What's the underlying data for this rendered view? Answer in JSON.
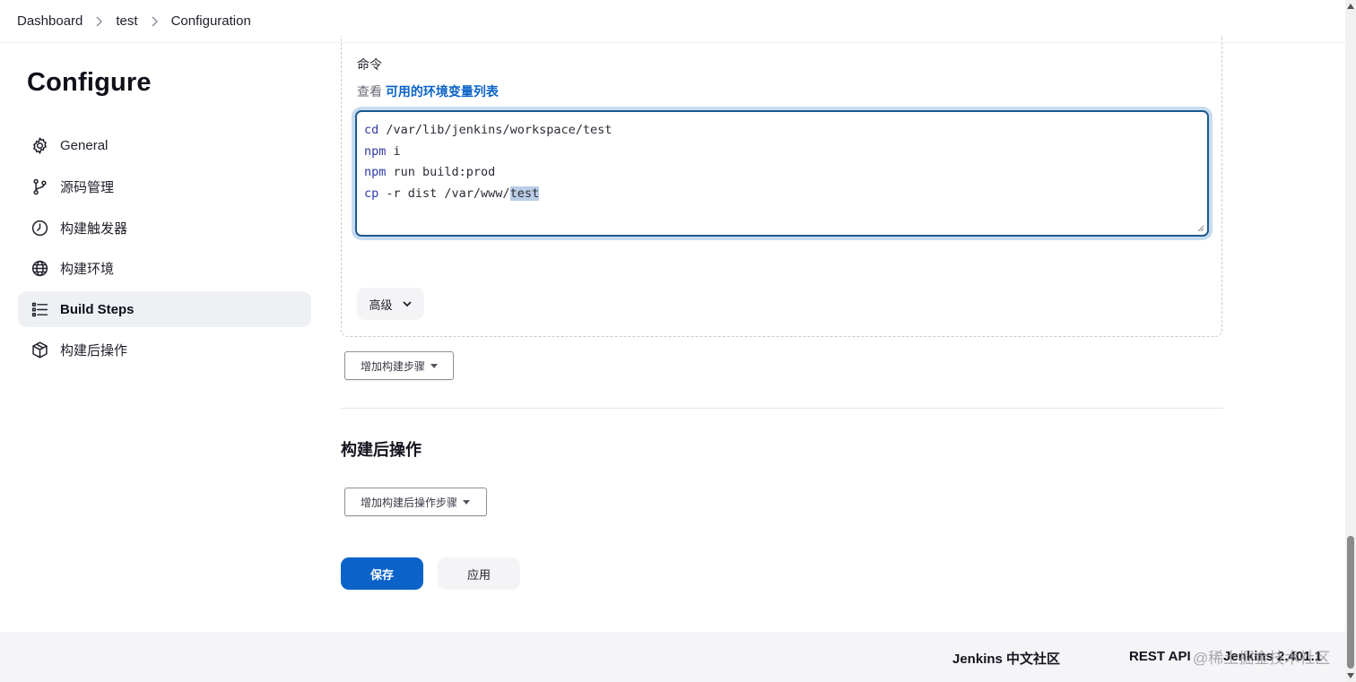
{
  "breadcrumb": {
    "items": [
      "Dashboard",
      "test",
      "Configuration"
    ]
  },
  "page": {
    "title": "Configure"
  },
  "sidebar": {
    "items": [
      {
        "label": "General",
        "icon": "gear-icon",
        "active": false
      },
      {
        "label": "源码管理",
        "icon": "source-branch-icon",
        "active": false
      },
      {
        "label": "构建触发器",
        "icon": "timer-icon",
        "active": false
      },
      {
        "label": "构建环境",
        "icon": "globe-icon",
        "active": false
      },
      {
        "label": "Build Steps",
        "icon": "list-icon",
        "active": true
      },
      {
        "label": "构建后操作",
        "icon": "cube-icon",
        "active": false
      }
    ]
  },
  "build_step": {
    "command_label": "命令",
    "env_hint_prefix": "查看",
    "env_link": "可用的环境变量列表",
    "command_lines": [
      {
        "kw": "cd",
        "rest": " /var/lib/jenkins/workspace/test"
      },
      {
        "kw": "npm",
        "rest": " i"
      },
      {
        "kw": "npm",
        "rest": " run build:prod"
      },
      {
        "kw": "cp",
        "rest": " -r dist /var/www/",
        "selected": "test"
      }
    ],
    "advanced_label": "高级",
    "add_step_label": "增加构建步骤"
  },
  "post_build": {
    "title": "构建后操作",
    "add_label": "增加构建后操作步骤"
  },
  "actions": {
    "save_label": "保存",
    "apply_label": "应用"
  },
  "footer": {
    "community_label": "Jenkins 中文社区",
    "rest_api_label": "REST API",
    "version_label": "Jenkins 2.401.1",
    "watermark": "@稀土掘金技术社区"
  },
  "colors": {
    "accent": "#0b63c9",
    "active_bg": "#eef0f4",
    "footer_bg": "#f5f5f7"
  }
}
